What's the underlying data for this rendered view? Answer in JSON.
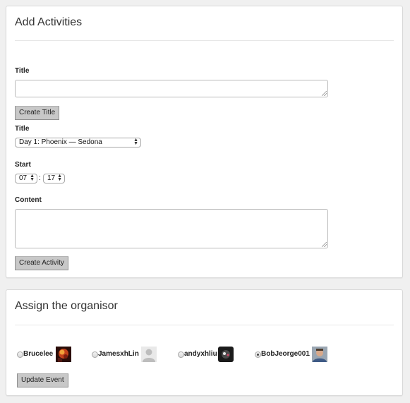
{
  "add_activities": {
    "heading": "Add Activities",
    "title_label": "Title",
    "title_value": "",
    "create_title_button": "Create Title",
    "title_select_label": "Title",
    "title_select_value": "Day 1: Phoenix — Sedona",
    "start_label": "Start",
    "start_hour": "07",
    "start_separator": ":",
    "start_minute": "17",
    "content_label": "Content",
    "content_value": "",
    "create_activity_button": "Create Activity"
  },
  "assign_organisor": {
    "heading": "Assign the organisor",
    "organisors": [
      {
        "name": "Brucelee",
        "selected": false,
        "avatar": "fire-photo-avatar"
      },
      {
        "name": "JamesxhLin",
        "selected": false,
        "avatar": "default-person-avatar"
      },
      {
        "name": "andyxhliu",
        "selected": false,
        "avatar": "dark-photo-avatar"
      },
      {
        "name": "BobJeorge001",
        "selected": true,
        "avatar": "man-photo-avatar"
      }
    ],
    "update_button": "Update Event"
  },
  "colors": {
    "page_background": "#f0f0f0",
    "panel_background": "#ffffff",
    "button_background": "#c8c8c8"
  }
}
